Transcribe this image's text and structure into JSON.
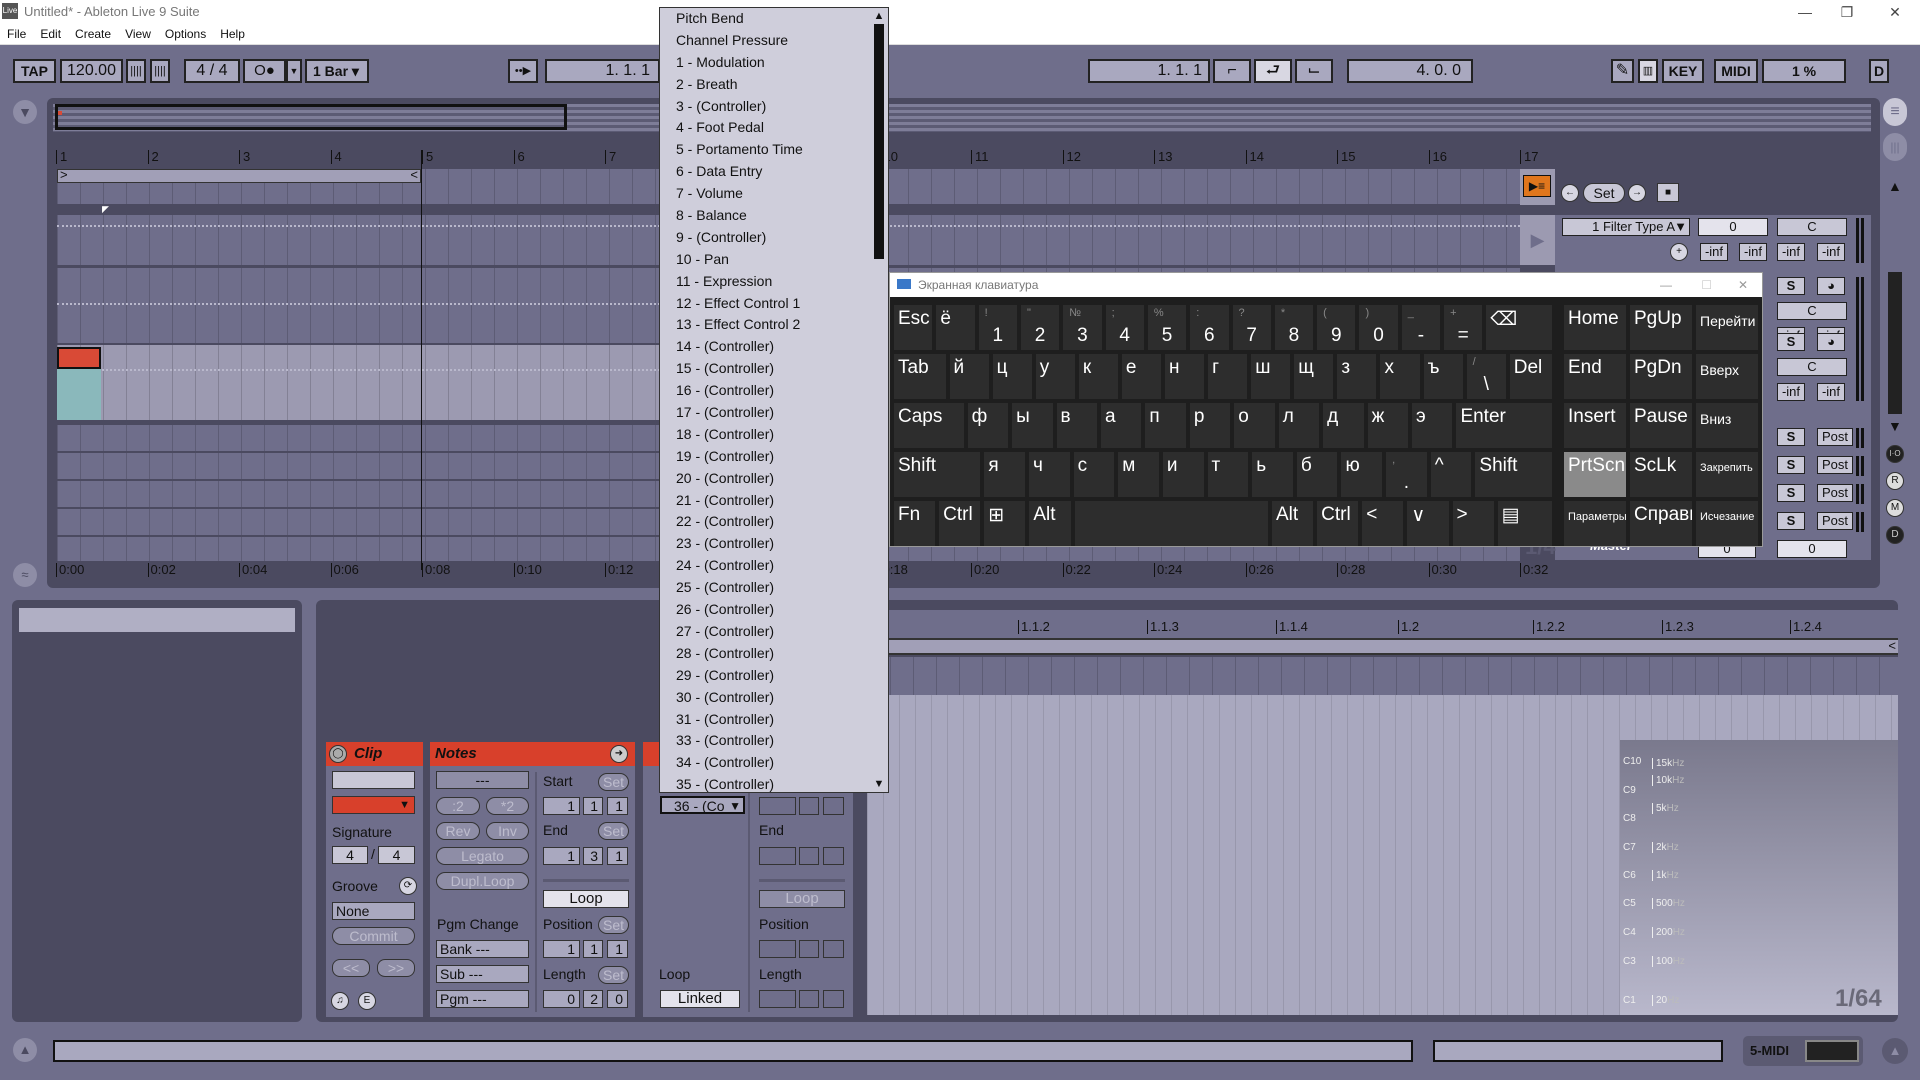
{
  "window": {
    "title": "Untitled* - Ableton Live 9 Suite",
    "logo": "Live",
    "controls": [
      "—",
      "❐",
      "✕"
    ]
  },
  "menu": [
    "File",
    "Edit",
    "Create",
    "View",
    "Options",
    "Help"
  ],
  "toolbar": {
    "tap": "TAP",
    "tempo": "120.00",
    "signature": "4 / 4",
    "metro": "O●",
    "quantize": "1 Bar",
    "follow_icon": "follow-icon",
    "position": "1.   1.   1",
    "loop_start": "1.   1.   1",
    "loop_length": "4.   0.   0",
    "key": "KEY",
    "midi": "MIDI",
    "cpu": "1 %",
    "d": "D"
  },
  "arrangement": {
    "bars": [
      "1",
      "2",
      "3",
      "4",
      "5",
      "6",
      "7",
      "8",
      "9",
      "10",
      "11",
      "12",
      "13",
      "14",
      "15",
      "16",
      "17"
    ],
    "times": [
      "0:00",
      "0:02",
      "0:04",
      "0:06",
      "0:08",
      "0:10",
      "0:12",
      "0:14",
      "0:16",
      "0:18",
      "0:20",
      "0:22",
      "0:24",
      "0:26",
      "0:28",
      "0:30",
      "0:32"
    ],
    "clip_color": "#d94a36",
    "clip_content_color": "#8ab8bb",
    "loop_brace": "1 – 5",
    "set_label": "Set",
    "time_sig": "1/4",
    "master": "Master"
  },
  "mixer": {
    "device": "1 Filter Type A",
    "vol": "0",
    "pan": "C",
    "inf": "-inf",
    "s": "S",
    "post": "Post",
    "master_vals": [
      "0",
      "0"
    ],
    "side": [
      "I·O",
      "R",
      "M",
      "D"
    ]
  },
  "dropdown": {
    "items": [
      "Pitch Bend",
      "Channel Pressure",
      "1 - Modulation",
      "2 - Breath",
      "3 - (Controller)",
      "4 - Foot Pedal",
      "5 - Portamento Time",
      "6 - Data Entry",
      "7 - Volume",
      "8 - Balance",
      "9 - (Controller)",
      "10 - Pan",
      "11 - Expression",
      "12 - Effect Control 1",
      "13 - Effect Control 2",
      "14 - (Controller)",
      "15 - (Controller)",
      "16 - (Controller)",
      "17 - (Controller)",
      "18 - (Controller)",
      "19 - (Controller)",
      "20 - (Controller)",
      "21 - (Controller)",
      "22 - (Controller)",
      "23 - (Controller)",
      "24 - (Controller)",
      "25 - (Controller)",
      "26 - (Controller)",
      "27 - (Controller)",
      "28 - (Controller)",
      "29 - (Controller)",
      "30 - (Controller)",
      "31 - (Controller)",
      "33 - (Controller)",
      "34 - (Controller)",
      "35 - (Controller)"
    ],
    "selected": "36 - (Co"
  },
  "osk": {
    "title": "Экранная клавиатура",
    "rows": [
      [
        {
          "k": "Esc"
        },
        {
          "k": "ё"
        },
        {
          "k": "1",
          "s": "!"
        },
        {
          "k": "2",
          "s": "\""
        },
        {
          "k": "3",
          "s": "№"
        },
        {
          "k": "4",
          "s": ";"
        },
        {
          "k": "5",
          "s": "%"
        },
        {
          "k": "6",
          "s": ":"
        },
        {
          "k": "7",
          "s": "?"
        },
        {
          "k": "8",
          "s": "*"
        },
        {
          "k": "9",
          "s": "("
        },
        {
          "k": "0",
          "s": ")"
        },
        {
          "k": "-",
          "s": "_"
        },
        {
          "k": "=",
          "s": "+"
        },
        {
          "k": "⌫"
        }
      ],
      [
        {
          "k": "Tab"
        },
        {
          "k": "й"
        },
        {
          "k": "ц"
        },
        {
          "k": "у"
        },
        {
          "k": "к"
        },
        {
          "k": "е"
        },
        {
          "k": "н"
        },
        {
          "k": "г"
        },
        {
          "k": "ш"
        },
        {
          "k": "щ"
        },
        {
          "k": "з"
        },
        {
          "k": "х"
        },
        {
          "k": "ъ"
        },
        {
          "k": "\\",
          "s": "/"
        },
        {
          "k": "Del"
        }
      ],
      [
        {
          "k": "Caps"
        },
        {
          "k": "ф"
        },
        {
          "k": "ы"
        },
        {
          "k": "в"
        },
        {
          "k": "а"
        },
        {
          "k": "п"
        },
        {
          "k": "р"
        },
        {
          "k": "о"
        },
        {
          "k": "л"
        },
        {
          "k": "д"
        },
        {
          "k": "ж"
        },
        {
          "k": "э"
        },
        {
          "k": "Enter"
        }
      ],
      [
        {
          "k": "Shift"
        },
        {
          "k": "я"
        },
        {
          "k": "ч"
        },
        {
          "k": "с"
        },
        {
          "k": "м"
        },
        {
          "k": "и"
        },
        {
          "k": "т"
        },
        {
          "k": "ь"
        },
        {
          "k": "б"
        },
        {
          "k": "ю"
        },
        {
          "k": ".",
          "s": ","
        },
        {
          "k": "^"
        },
        {
          "k": "Shift"
        }
      ],
      [
        {
          "k": "Fn"
        },
        {
          "k": "Ctrl"
        },
        {
          "k": "⊞"
        },
        {
          "k": "Alt"
        },
        {
          "k": ""
        },
        {
          "k": "Alt"
        },
        {
          "k": "Ctrl"
        },
        {
          "k": "<"
        },
        {
          "k": "∨"
        },
        {
          "k": ">"
        },
        {
          "k": "▤"
        }
      ]
    ],
    "nav": [
      "Home",
      "PgUp",
      "Перейти",
      "End",
      "PgDn",
      "Вверх",
      "Insert",
      "Pause",
      "Вниз",
      "PrtScn",
      "ScLk",
      "Закрепить",
      "Параметры",
      "Справка",
      "Исчезание"
    ],
    "highlighted": "PrtScn"
  },
  "clip": {
    "title": "Clip",
    "signature_label": "Signature",
    "sig_num": "4",
    "sig_den": "4",
    "groove_label": "Groove",
    "groove": "None",
    "commit": "Commit",
    "prev": "<<",
    "next": ">>",
    "color": "#d94a36"
  },
  "notes": {
    "title": "Notes",
    "field": "---",
    "half": ":2",
    "double": "*2",
    "rev": "Rev",
    "inv": "Inv",
    "legato": "Legato",
    "dupl": "Dupl.Loop",
    "pgm_label": "Pgm Change",
    "bank": "Bank ---",
    "sub": "Sub ---",
    "pgm": "Pgm ---",
    "start_label": "Start",
    "end_label": "End",
    "set": "Set",
    "start": [
      "1",
      "1",
      "1"
    ],
    "end": [
      "1",
      "3",
      "1"
    ],
    "loop": "Loop",
    "position_label": "Position",
    "position": [
      "1",
      "1",
      "1"
    ],
    "length_label": "Length",
    "length": [
      "0",
      "2",
      "0"
    ]
  },
  "envelope": {
    "loop_label": "Loop",
    "linked": "Linked",
    "end_label": "End",
    "loop": "Loop",
    "position_label": "Position",
    "length_label": "Length"
  },
  "pianoroll": {
    "ruler": [
      "1.1.2",
      "1.1.3",
      "1.1.4",
      "1.2",
      "1.2.2",
      "1.2.3",
      "1.2.4"
    ],
    "notes": [
      "C10",
      "C9",
      "C8",
      "C7",
      "C6",
      "C5",
      "C4",
      "C3",
      "C1"
    ],
    "freqs": [
      "15k",
      "10k",
      "5k",
      "2k",
      "1k",
      "500",
      "200",
      "100",
      "20"
    ],
    "hz": "Hz",
    "grid": "1/64"
  },
  "status": {
    "track": "5-MIDI"
  }
}
